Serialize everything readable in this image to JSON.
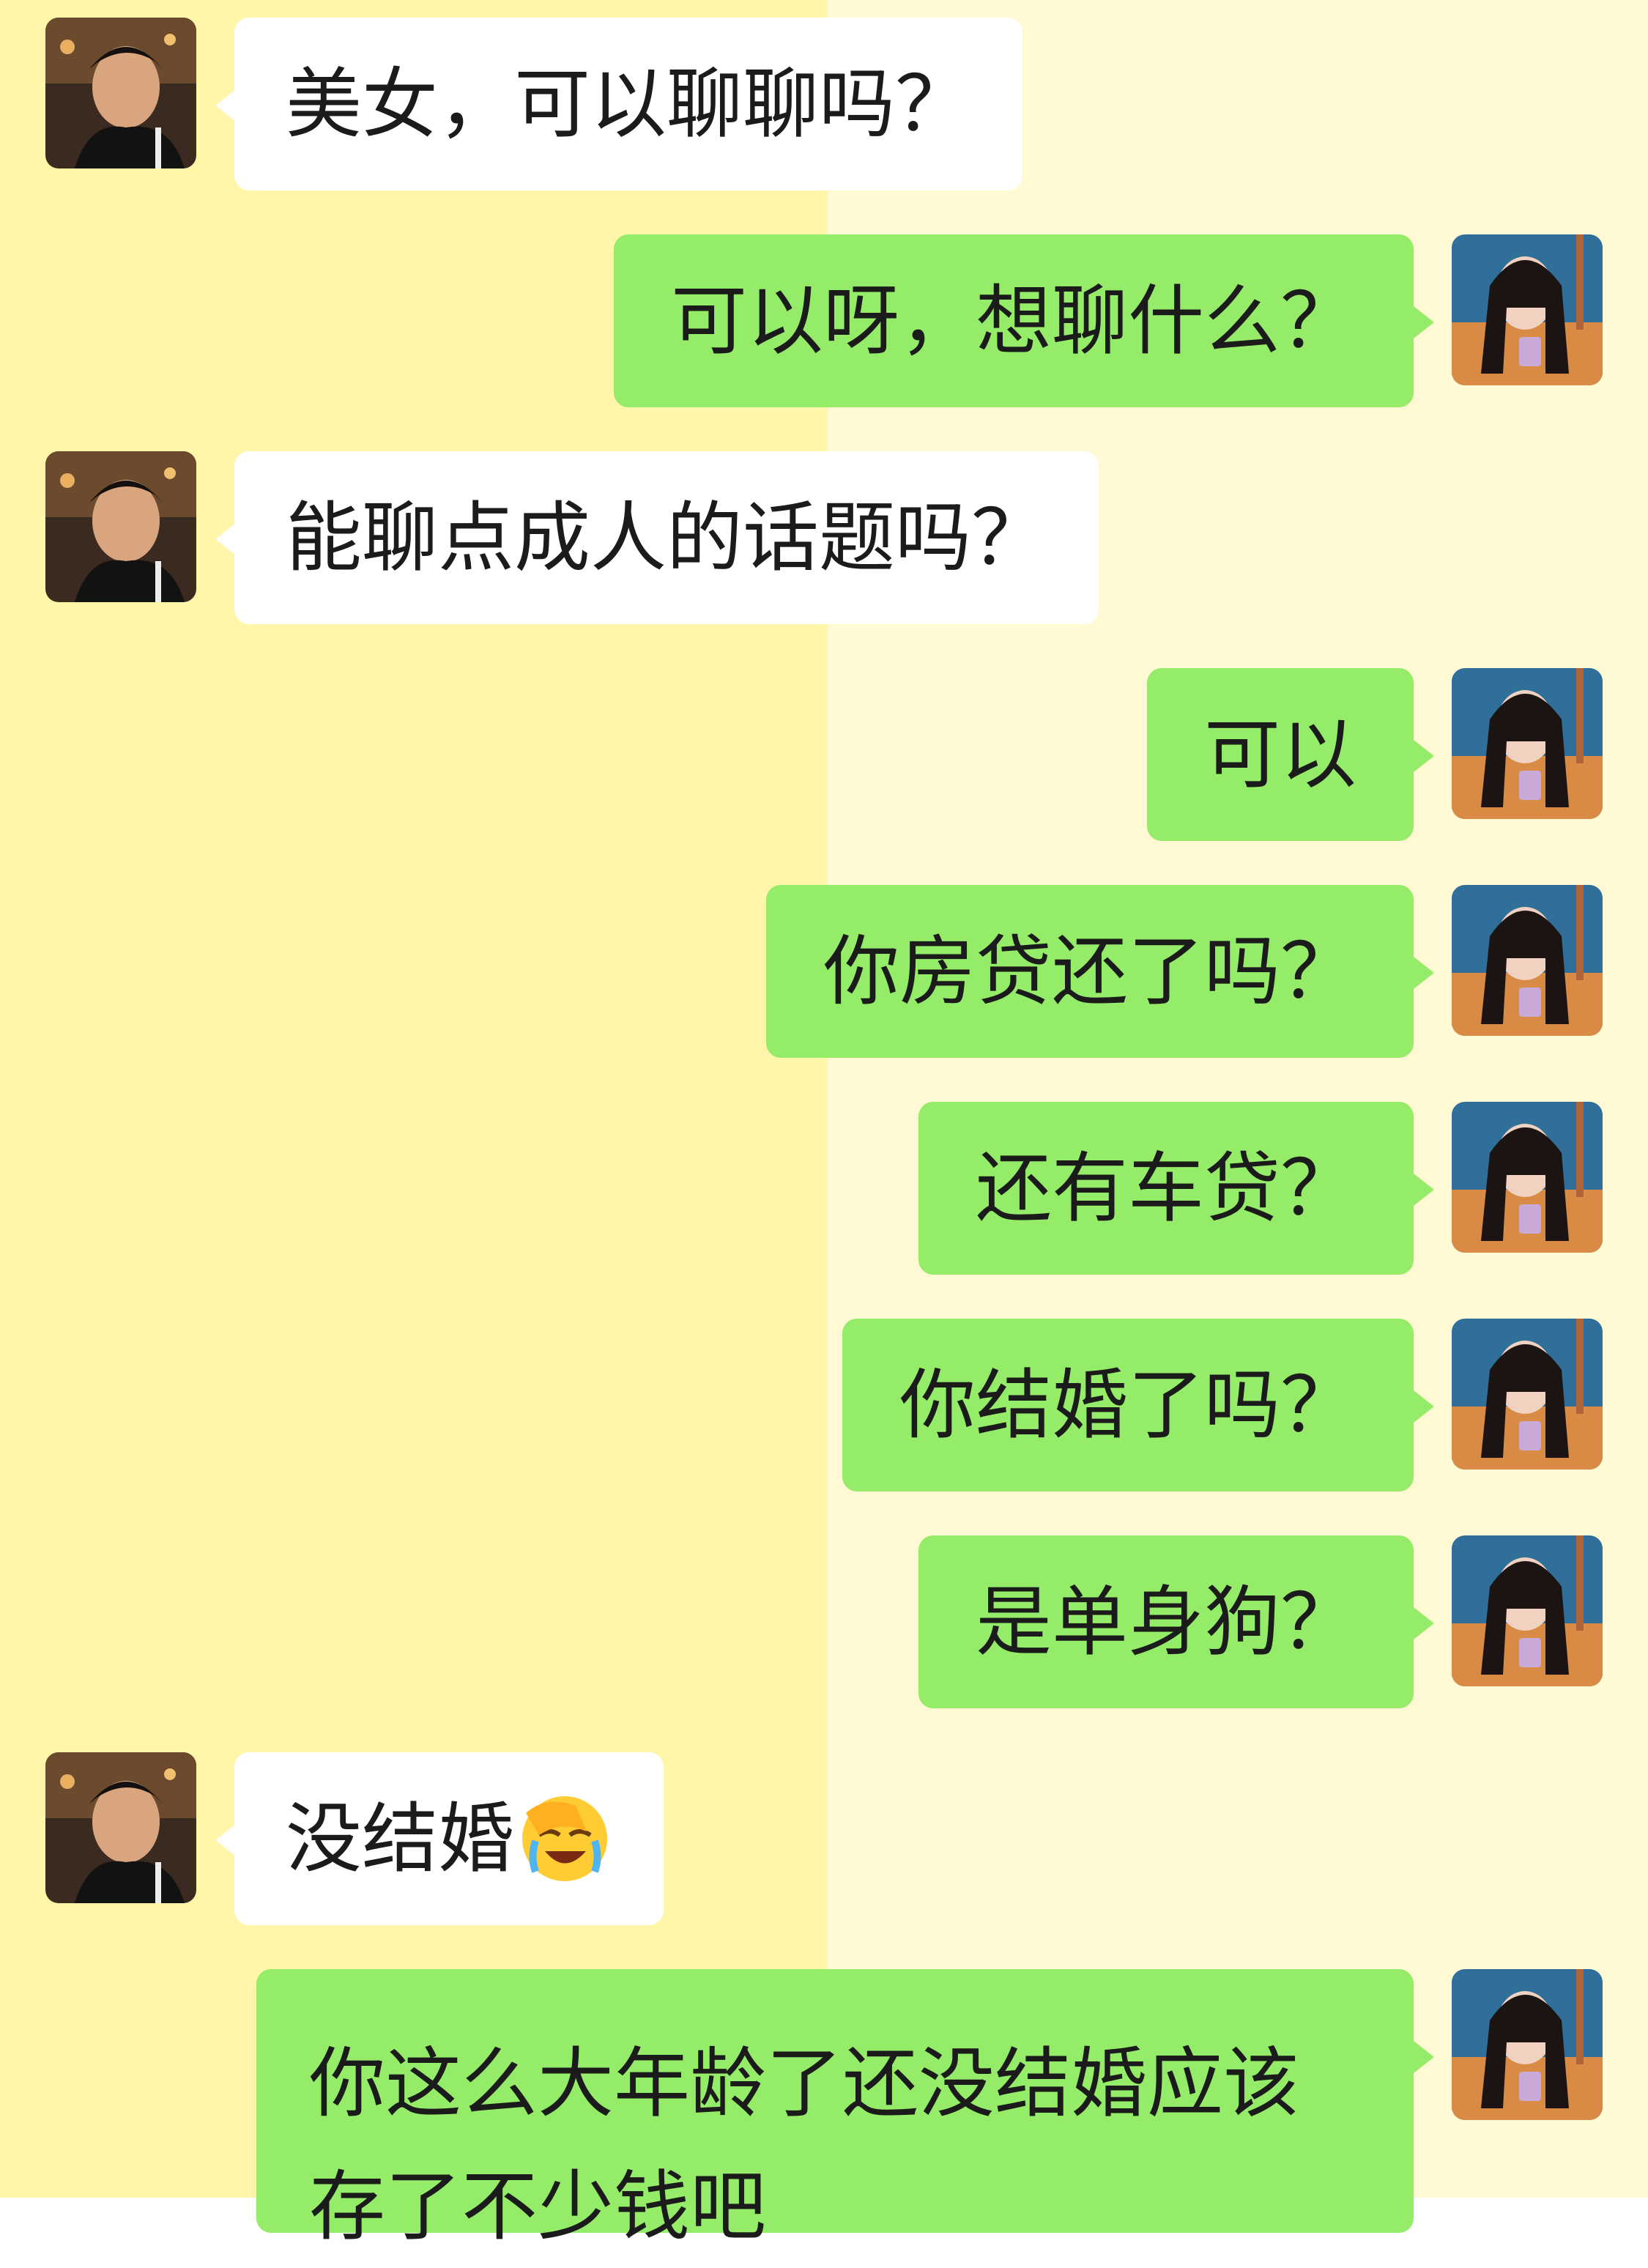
{
  "messages": [
    {
      "side": "in",
      "text": "美女，可以聊聊吗？"
    },
    {
      "side": "out",
      "text": "可以呀，想聊什么？"
    },
    {
      "side": "in",
      "text": "能聊点成人的话题吗？"
    },
    {
      "side": "out",
      "text": "可以"
    },
    {
      "side": "out",
      "text": "你房贷还了吗？"
    },
    {
      "side": "out",
      "text": "还有车贷？"
    },
    {
      "side": "out",
      "text": "你结婚了吗？"
    },
    {
      "side": "out",
      "text": "是单身狗？"
    },
    {
      "side": "in",
      "text": "没结婚",
      "emoji": "face-palm-laughing-emoji"
    },
    {
      "side": "out",
      "text": "你这么大年龄了还没结婚应该存了不少钱吧"
    }
  ],
  "avatars": {
    "in": "male-user-avatar",
    "out": "female-user-avatar"
  },
  "colors": {
    "background_left": "#fff6a9",
    "background_right": "#fffad3",
    "incoming_bubble": "#ffffff",
    "outgoing_bubble": "#95ec69",
    "text": "#1b1b1b"
  }
}
